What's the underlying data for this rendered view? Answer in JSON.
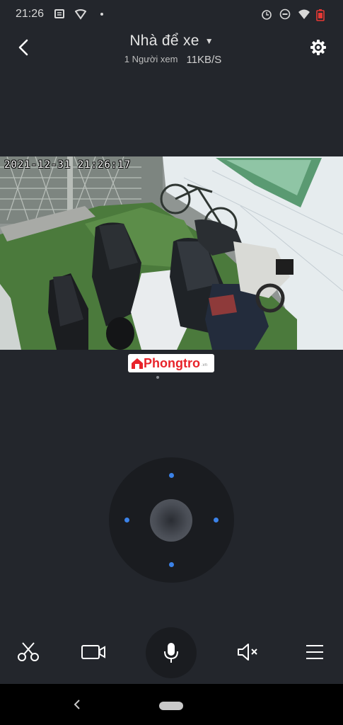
{
  "status_bar": {
    "time": "21:26",
    "icons": [
      "message-icon",
      "vpn-icon",
      "dot-icon",
      "alarm-icon",
      "dnd-icon",
      "wifi-icon",
      "battery-low-icon"
    ],
    "battery_color": "#e53935"
  },
  "header": {
    "title": "Nhà để xe",
    "viewers": "1 Người xem",
    "bitrate": "11KB/S"
  },
  "video": {
    "timestamp": "2021-12-31 21:26:17"
  },
  "watermark": {
    "brand": "Phongtro",
    "suffix": ".vn"
  },
  "ptz": {
    "accent_color": "#3b82e8"
  },
  "toolbar": {
    "buttons": [
      "scissors-icon",
      "video-record-icon",
      "microphone-icon",
      "mute-icon",
      "menu-icon"
    ]
  },
  "colors": {
    "background": "#23262c",
    "panel": "#1a1c20"
  }
}
